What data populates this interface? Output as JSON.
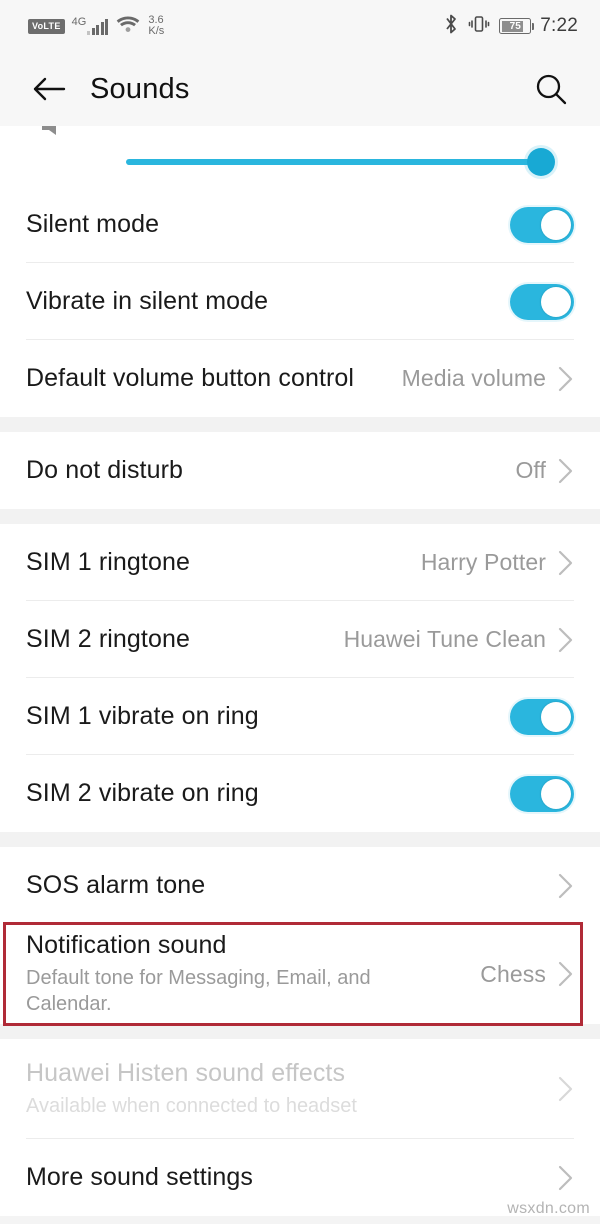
{
  "status_bar": {
    "volte_label": "VoLTE",
    "network_generation": "4G",
    "data_speed_value": "3.6",
    "data_speed_unit": "K/s",
    "battery_percent": "75",
    "clock": "7:22",
    "icons": [
      "volte-icon",
      "signal-bars-icon",
      "wifi-icon",
      "bluetooth-icon",
      "vibrate-icon",
      "battery-icon"
    ]
  },
  "app_bar": {
    "back_label": "back-arrow",
    "title": "Sounds",
    "search_label": "search"
  },
  "accent_colors": {
    "toggle_on": "#2ab6de",
    "slider": "#2ab6de",
    "slider_knob": "#18a9d4",
    "highlight_border": "#b02a37",
    "section_gap": "#f2f2f2",
    "primary_text": "#1a1a1a",
    "secondary_text": "#9a9a9a",
    "disabled_text": "#c6c6c6"
  },
  "sections": [
    {
      "id": "volume-section",
      "rows": [
        {
          "id": "media-volume-slider",
          "type": "slider",
          "value_percent": 100
        }
      ]
    },
    {
      "id": "silent-section",
      "rows": [
        {
          "id": "silent-mode",
          "type": "toggle",
          "label": "Silent mode",
          "checked": true
        },
        {
          "id": "vibrate-in-silent-mode",
          "type": "toggle",
          "label": "Vibrate in silent mode",
          "checked": true
        },
        {
          "id": "default-volume-button-control",
          "type": "value",
          "label": "Default volume button control",
          "value": "Media volume"
        }
      ]
    },
    {
      "id": "dnd-section",
      "rows": [
        {
          "id": "do-not-disturb",
          "type": "value",
          "label": "Do not disturb",
          "value": "Off"
        }
      ]
    },
    {
      "id": "sim-section",
      "rows": [
        {
          "id": "sim-1-ringtone",
          "type": "value",
          "label": "SIM 1 ringtone",
          "value": "Harry Potter"
        },
        {
          "id": "sim-2-ringtone",
          "type": "value",
          "label": "SIM 2 ringtone",
          "value": "Huawei Tune Clean"
        },
        {
          "id": "sim-1-vibrate-on-ring",
          "type": "toggle",
          "label": "SIM 1 vibrate on ring",
          "checked": true
        },
        {
          "id": "sim-2-vibrate-on-ring",
          "type": "toggle",
          "label": "SIM 2 vibrate on ring",
          "checked": true
        }
      ]
    },
    {
      "id": "tones-section",
      "rows": [
        {
          "id": "sos-alarm-tone",
          "type": "chevron",
          "label": "SOS alarm tone"
        },
        {
          "id": "notification-sound",
          "type": "value",
          "label": "Notification sound",
          "sublabel": "Default tone for Messaging, Email, and Calendar.",
          "value": "Chess",
          "highlighted": true
        }
      ]
    },
    {
      "id": "effects-section",
      "rows": [
        {
          "id": "huawei-histen-sound-effects",
          "type": "chevron",
          "label": "Huawei Histen sound effects",
          "sublabel": "Available when connected to headset",
          "disabled": true
        },
        {
          "id": "more-sound-settings",
          "type": "chevron",
          "label": "More sound settings"
        }
      ]
    }
  ],
  "watermark": "wsxdn.com"
}
